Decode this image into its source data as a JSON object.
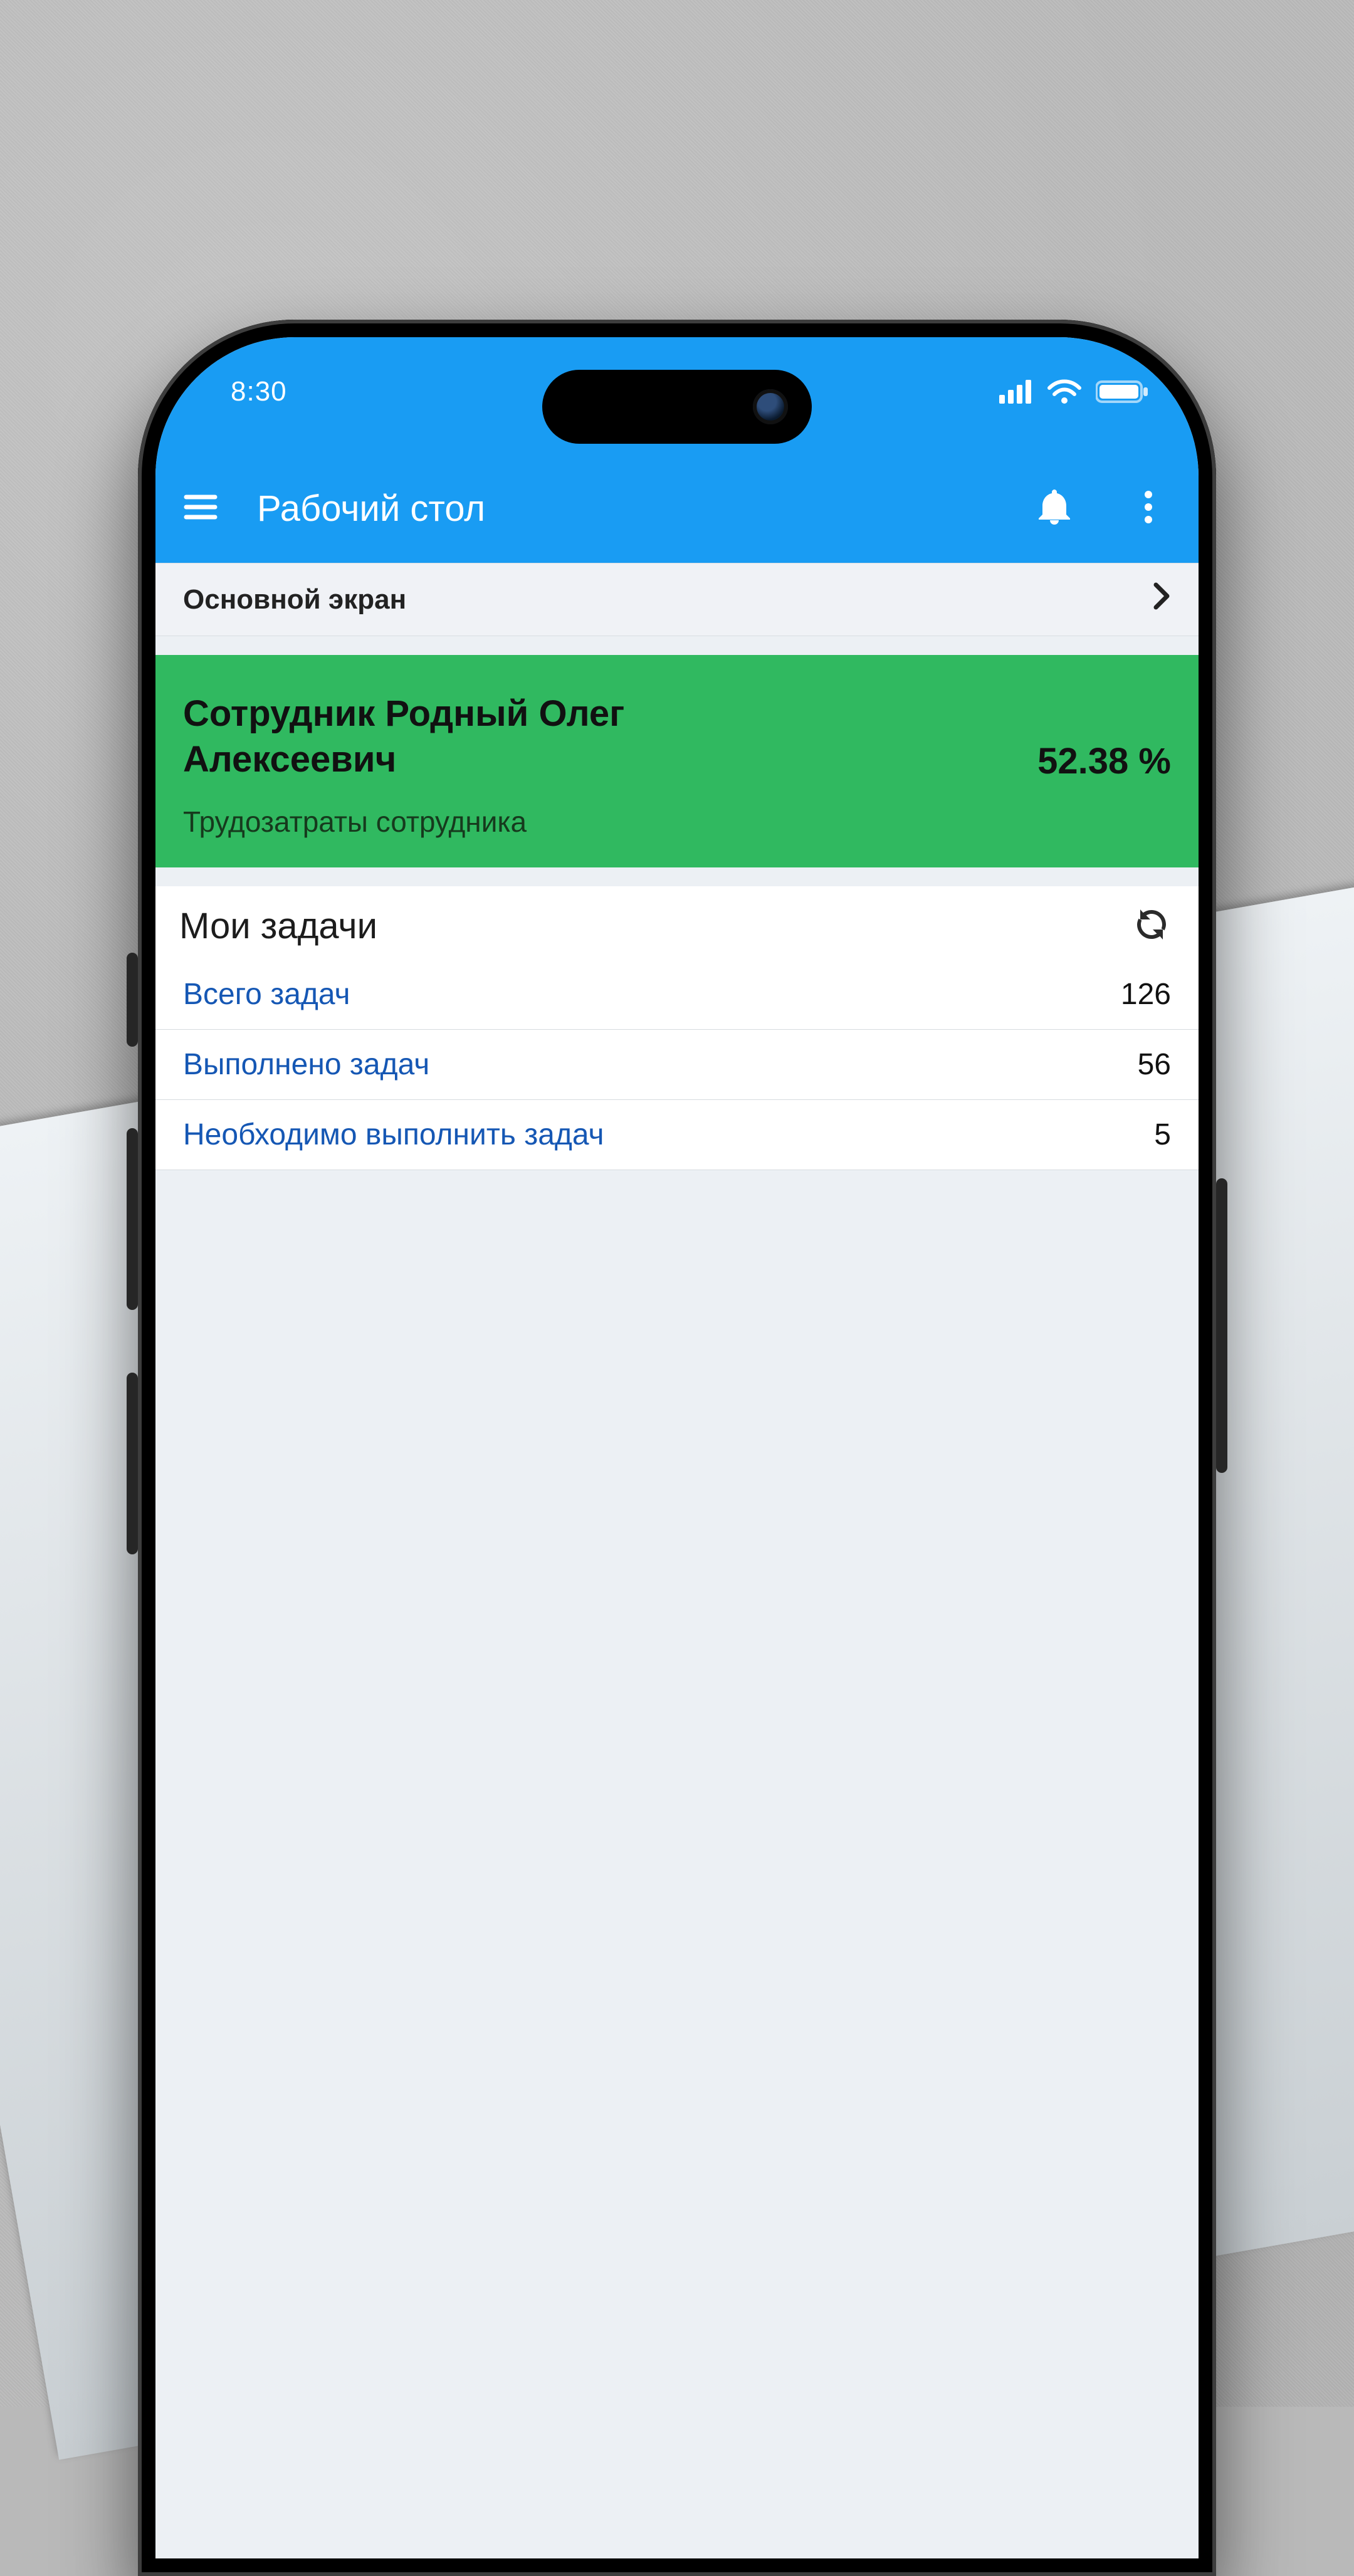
{
  "status": {
    "time": "8:30"
  },
  "appbar": {
    "title": "Рабочий стол"
  },
  "subnav": {
    "label": "Основной экран"
  },
  "employee": {
    "name": "Сотрудник Родный Олег Алексеевич",
    "percent": "52.38 %",
    "subtitle": "Трудозатраты сотрудника"
  },
  "tasks": {
    "title": "Мои задачи",
    "rows": [
      {
        "label": "Всего задач",
        "value": "126"
      },
      {
        "label": "Выполнено задач",
        "value": "56"
      },
      {
        "label": "Необходимо выполнить задач",
        "value": "5"
      }
    ]
  },
  "colors": {
    "accent": "#199cf3",
    "card": "#30b960",
    "link": "#1557b4"
  }
}
